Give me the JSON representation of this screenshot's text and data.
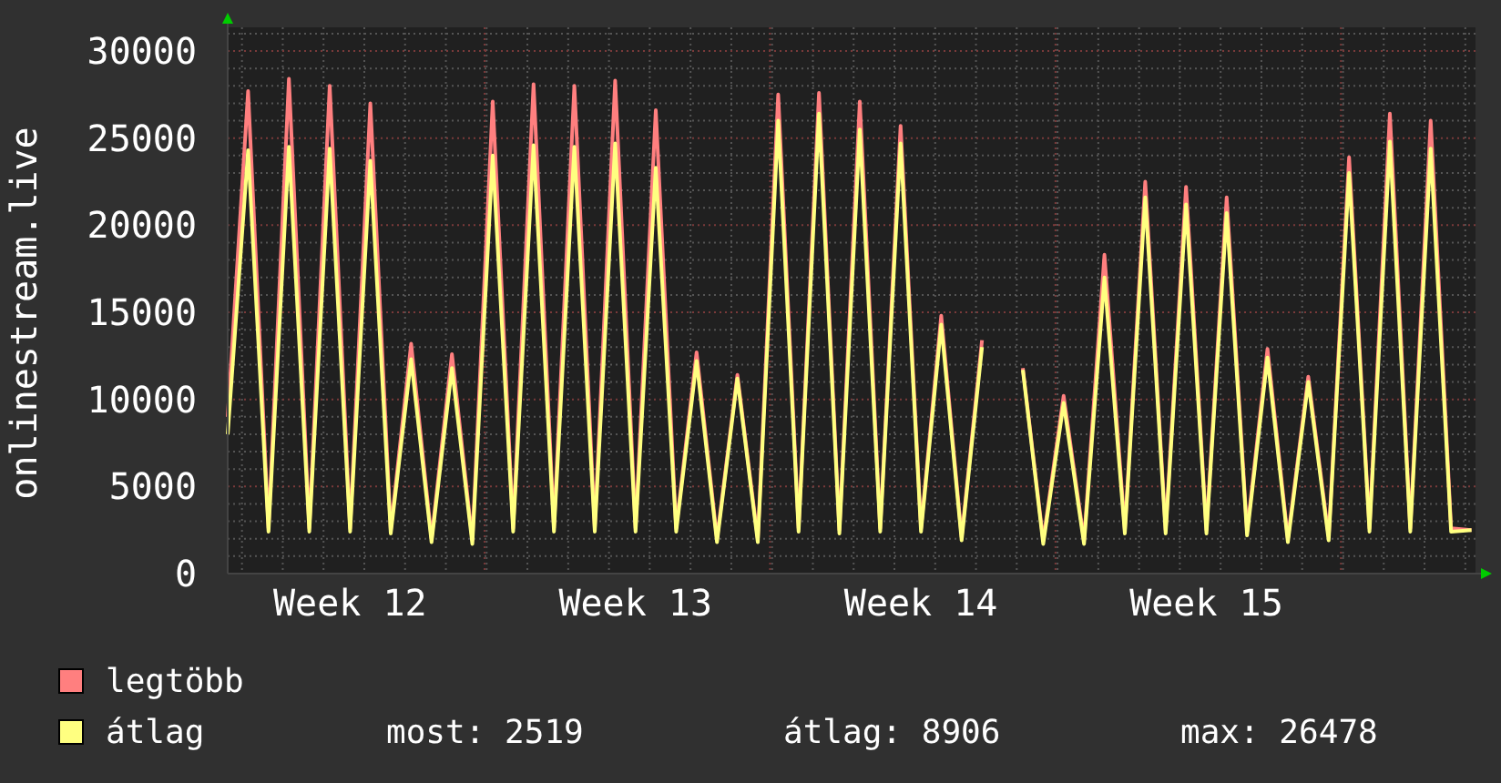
{
  "chart": {
    "chart_data": {
      "type": "line",
      "grid": true,
      "ylabel": "onlinestream.live",
      "ylim": [
        0,
        31360
      ],
      "yticks": [
        0,
        5000,
        10000,
        15000,
        20000,
        25000,
        30000
      ],
      "categories": [
        null,
        null,
        null,
        null,
        null,
        null,
        "Week 12",
        null,
        null,
        null,
        null,
        null,
        null,
        null,
        null,
        null,
        null,
        null,
        null,
        null,
        "Week 13",
        null,
        null,
        null,
        null,
        null,
        null,
        null,
        null,
        null,
        null,
        null,
        null,
        null,
        "Week 14",
        null,
        null,
        null,
        null,
        null,
        null,
        null,
        null,
        null,
        null,
        null,
        null,
        null,
        "Week 15",
        null,
        null,
        null,
        null,
        null,
        null,
        null,
        null,
        null,
        null,
        null,
        null,
        null
      ],
      "series": [
        {
          "name": "legtöbb",
          "color": "#ff7f7f",
          "values": [
            9000,
            27700,
            2600,
            28400,
            2600,
            28000,
            2600,
            27000,
            2500,
            13200,
            2000,
            12600,
            1900,
            27100,
            2600,
            28100,
            2600,
            28000,
            2600,
            28300,
            2600,
            26600,
            2600,
            12700,
            2000,
            11400,
            2000,
            27500,
            2600,
            27600,
            2500,
            27100,
            2600,
            25700,
            2600,
            14800,
            2100,
            13400,
            null,
            11800,
            1900,
            10200,
            1900,
            18300,
            2500,
            22500,
            2500,
            22200,
            2500,
            21600,
            2400,
            12900,
            2000,
            11300,
            2100,
            23900,
            2600,
            26400,
            2600,
            26000,
            2600,
            2500
          ]
        },
        {
          "name": "átlag",
          "color": "#ffff80",
          "values": [
            8000,
            24300,
            2400,
            24500,
            2400,
            24400,
            2400,
            23700,
            2300,
            12300,
            1800,
            11800,
            1700,
            24000,
            2400,
            24600,
            2400,
            24500,
            2400,
            24700,
            2400,
            23300,
            2400,
            12200,
            1800,
            11200,
            1800,
            26000,
            2400,
            26400,
            2300,
            25500,
            2400,
            24700,
            2400,
            14300,
            1900,
            13000,
            null,
            11700,
            1700,
            9800,
            1700,
            17000,
            2300,
            21600,
            2300,
            21200,
            2300,
            20700,
            2200,
            12400,
            1800,
            11000,
            1900,
            23000,
            2400,
            24800,
            2400,
            24400,
            2400,
            2500
          ]
        }
      ]
    }
  },
  "legend_stats": [
    "most: 2519",
    "átlag: 8906",
    "max: 26478"
  ]
}
